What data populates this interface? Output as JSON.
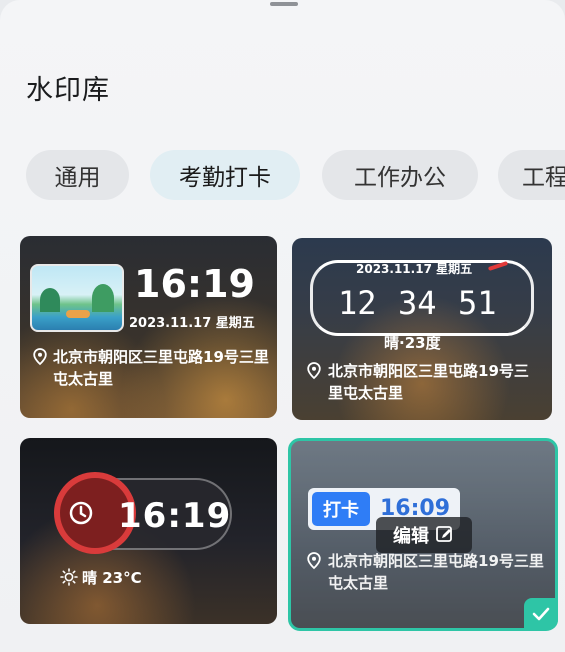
{
  "title": "水印库",
  "tabs": [
    {
      "label": "通用"
    },
    {
      "label": "考勤打卡"
    },
    {
      "label": "工作办公"
    },
    {
      "label": "工程"
    }
  ],
  "cards": [
    {
      "time": "16:19",
      "date": "2023.11.17",
      "weekday": "星期五",
      "address": "北京市朝阳区三里屯路19号三里屯太古里"
    },
    {
      "date_line": "2023.11.17 星期五",
      "hour": "12",
      "minute": "34",
      "second": "51",
      "weather": "晴·23度",
      "address": "北京市朝阳区三里屯路19号三里屯太古里"
    },
    {
      "time": "16:19",
      "weather": "晴 23°C"
    },
    {
      "badge": "打卡",
      "time": "16:09",
      "edit_label": "编辑",
      "address": "北京市朝阳区三里屯路19号三里屯太古里",
      "selected": true
    }
  ],
  "icons": {
    "location": "location-pin-icon",
    "edit": "edit-icon",
    "check": "check-icon",
    "clock": "clock-icon",
    "sun": "sun-icon"
  },
  "colors": {
    "accent": "#2ec5a6",
    "badge": "#2f7df6",
    "clock_red": "#e23a3a"
  }
}
